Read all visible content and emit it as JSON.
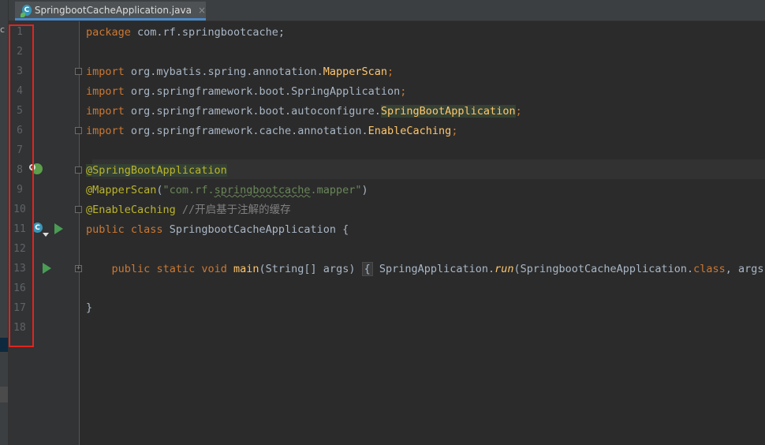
{
  "left_panel": {
    "fragments": [
      "c"
    ]
  },
  "tab": {
    "icon_letter": "C",
    "label": "SpringbootCacheApplication.java",
    "close": "×"
  },
  "line_numbers": [
    "1",
    "2",
    "3",
    "4",
    "5",
    "6",
    "7",
    "8",
    "9",
    "10",
    "11",
    "12",
    "13",
    "16",
    "17",
    "18"
  ],
  "code": {
    "l1": {
      "kw": "package",
      "rest": " com.rf.springbootcache;"
    },
    "l3": {
      "kw": "import",
      "pkg": " org.mybatis.spring.annotation.",
      "cls": "MapperScan",
      "semi": ";"
    },
    "l4": {
      "kw": "import",
      "pkg": " org.springframework.boot.SpringApplication",
      "semi": ";"
    },
    "l5": {
      "kw": "import",
      "pkg": " org.springframework.boot.autoconfigure.",
      "cls": "SpringBootApplication",
      "semi": ";"
    },
    "l6": {
      "kw": "import",
      "pkg": " org.springframework.cache.annotation.",
      "cls": "EnableCaching",
      "semi": ";"
    },
    "l8": {
      "ann": "@SpringBootApplication"
    },
    "l9": {
      "ann": "@MapperScan",
      "open": "(",
      "str_a": "\"com.rf.",
      "str_b": "springbootcache",
      "str_c": ".mapper\"",
      "close": ")"
    },
    "l10": {
      "ann": "@EnableCaching",
      "comment": " //开启基于注解的缓存"
    },
    "l11": {
      "kw1": "public",
      "kw2": "class",
      "name": " SpringbootCacheApplication {"
    },
    "l13": {
      "kw1": "public",
      "kw2": "static",
      "kw3": "void",
      "fn": "main",
      "params": "(String[] args) ",
      "brace": "{",
      "call_a": " SpringApplication.",
      "call_fn": "run",
      "call_b": "(SpringbootCacheApplication.",
      "kw4": "class",
      "call_c": ", args);"
    },
    "l17": {
      "text": "}"
    }
  }
}
